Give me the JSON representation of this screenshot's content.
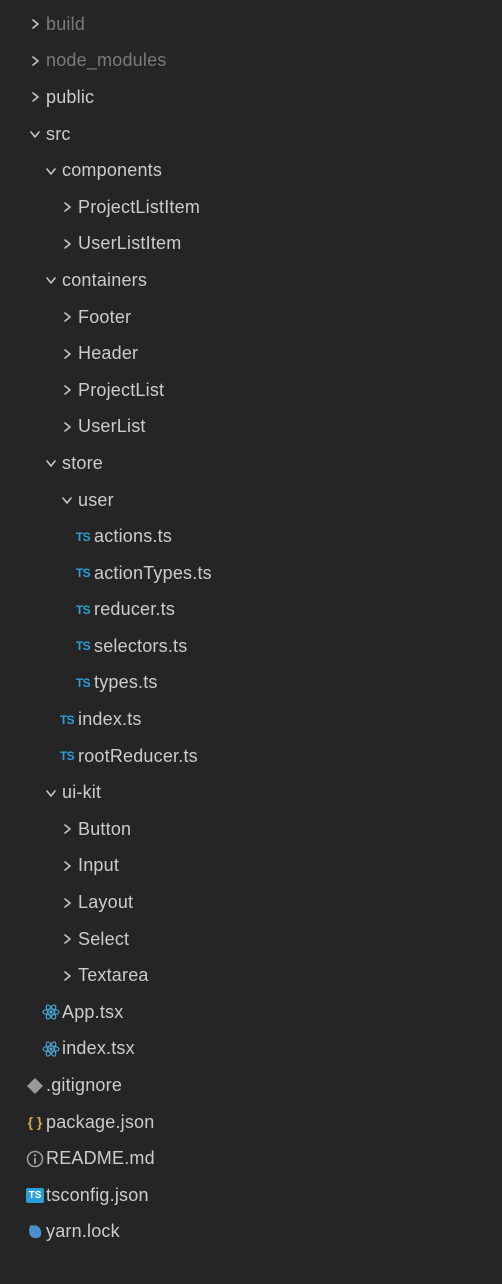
{
  "tree": [
    {
      "label": "build",
      "indent": 0,
      "kind": "folder",
      "state": "closed",
      "dim": true
    },
    {
      "label": "node_modules",
      "indent": 0,
      "kind": "folder",
      "state": "closed",
      "dim": true
    },
    {
      "label": "public",
      "indent": 0,
      "kind": "folder",
      "state": "closed"
    },
    {
      "label": "src",
      "indent": 0,
      "kind": "folder",
      "state": "open"
    },
    {
      "label": "components",
      "indent": 1,
      "kind": "folder",
      "state": "open"
    },
    {
      "label": "ProjectListItem",
      "indent": 2,
      "kind": "folder",
      "state": "closed"
    },
    {
      "label": "UserListItem",
      "indent": 2,
      "kind": "folder",
      "state": "closed"
    },
    {
      "label": "containers",
      "indent": 1,
      "kind": "folder",
      "state": "open"
    },
    {
      "label": "Footer",
      "indent": 2,
      "kind": "folder",
      "state": "closed"
    },
    {
      "label": "Header",
      "indent": 2,
      "kind": "folder",
      "state": "closed"
    },
    {
      "label": "ProjectList",
      "indent": 2,
      "kind": "folder",
      "state": "closed"
    },
    {
      "label": "UserList",
      "indent": 2,
      "kind": "folder",
      "state": "closed"
    },
    {
      "label": "store",
      "indent": 1,
      "kind": "folder",
      "state": "open"
    },
    {
      "label": "user",
      "indent": 2,
      "kind": "folder",
      "state": "open"
    },
    {
      "label": "actions.ts",
      "indent": 3,
      "kind": "ts"
    },
    {
      "label": "actionTypes.ts",
      "indent": 3,
      "kind": "ts"
    },
    {
      "label": "reducer.ts",
      "indent": 3,
      "kind": "ts"
    },
    {
      "label": "selectors.ts",
      "indent": 3,
      "kind": "ts"
    },
    {
      "label": "types.ts",
      "indent": 3,
      "kind": "ts"
    },
    {
      "label": "index.ts",
      "indent": 2,
      "kind": "ts"
    },
    {
      "label": "rootReducer.ts",
      "indent": 2,
      "kind": "ts"
    },
    {
      "label": "ui-kit",
      "indent": 1,
      "kind": "folder",
      "state": "open"
    },
    {
      "label": "Button",
      "indent": 2,
      "kind": "folder",
      "state": "closed"
    },
    {
      "label": "Input",
      "indent": 2,
      "kind": "folder",
      "state": "closed"
    },
    {
      "label": "Layout",
      "indent": 2,
      "kind": "folder",
      "state": "closed"
    },
    {
      "label": "Select",
      "indent": 2,
      "kind": "folder",
      "state": "closed"
    },
    {
      "label": "Textarea",
      "indent": 2,
      "kind": "folder",
      "state": "closed"
    },
    {
      "label": "App.tsx",
      "indent": 1,
      "kind": "react"
    },
    {
      "label": "index.tsx",
      "indent": 1,
      "kind": "react"
    },
    {
      "label": ".gitignore",
      "indent": 0,
      "kind": "git"
    },
    {
      "label": "package.json",
      "indent": 0,
      "kind": "json"
    },
    {
      "label": "README.md",
      "indent": 0,
      "kind": "info"
    },
    {
      "label": "tsconfig.json",
      "indent": 0,
      "kind": "tsbox"
    },
    {
      "label": "yarn.lock",
      "indent": 0,
      "kind": "yarn"
    }
  ],
  "iconText": {
    "ts": "TS",
    "tsbox": "TS",
    "json": "{ }"
  }
}
